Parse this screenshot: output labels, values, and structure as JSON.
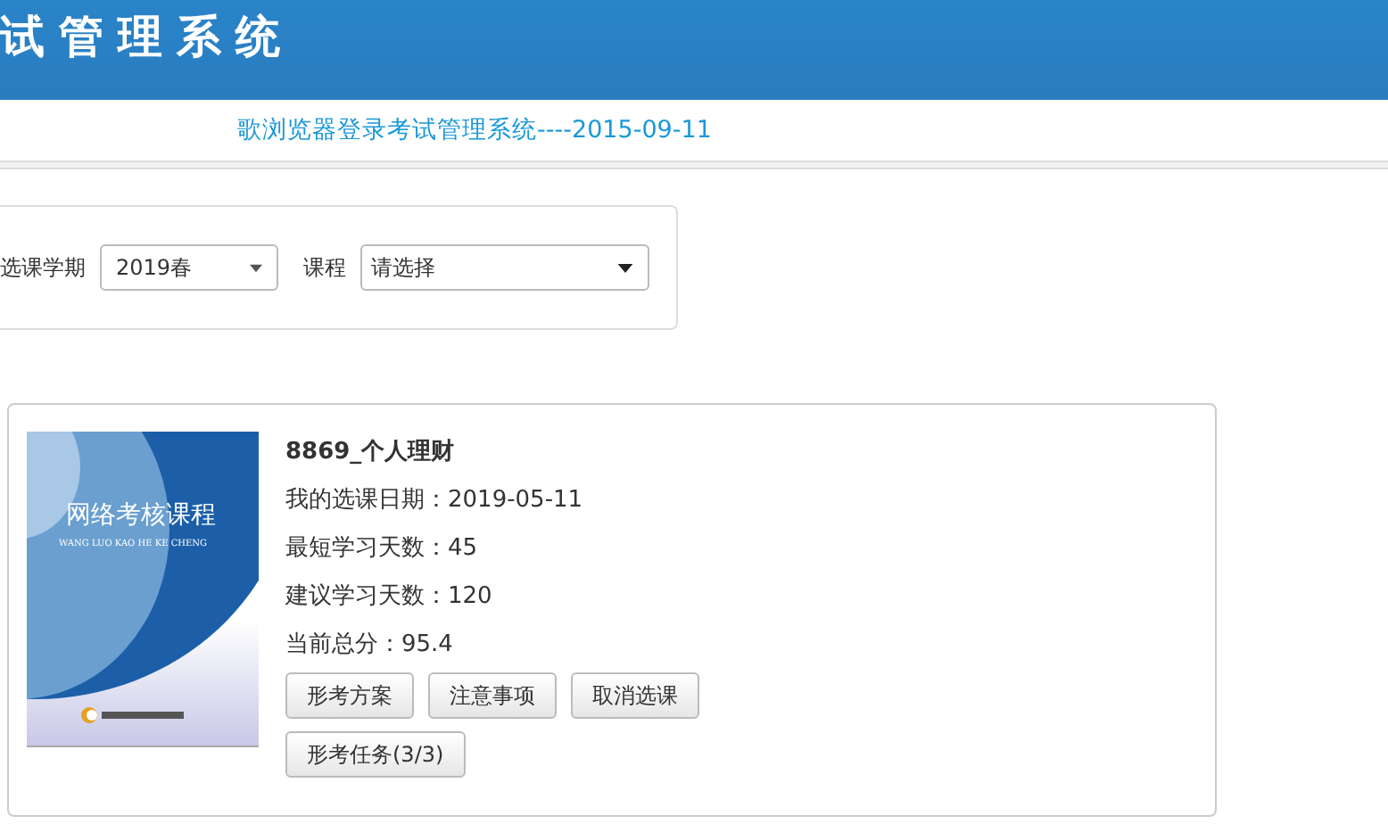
{
  "header": {
    "title": "试管理系统"
  },
  "notice": {
    "text": "歌浏览器登录考试管理系统----2015-09-11"
  },
  "filters": [
    {
      "label": "选课学期",
      "value": "2019春",
      "kind": "small"
    },
    {
      "label": "课程",
      "value": "请选择",
      "kind": "wide"
    }
  ],
  "course": {
    "cover": {
      "title": "网络考核课程",
      "subtitle": "WANG LUO KAO HE KE CHENG"
    },
    "title": "8869_个人理财",
    "details": [
      {
        "label": "我的选课日期：",
        "value": "2019-05-11"
      },
      {
        "label": "最短学习天数：",
        "value": "45"
      },
      {
        "label": "建议学习天数：",
        "value": "120"
      },
      {
        "label": "当前总分：",
        "value": "95.4"
      }
    ],
    "buttons": [
      "形考方案",
      "注意事项",
      "取消选课",
      "形考任务(3/3)"
    ]
  }
}
